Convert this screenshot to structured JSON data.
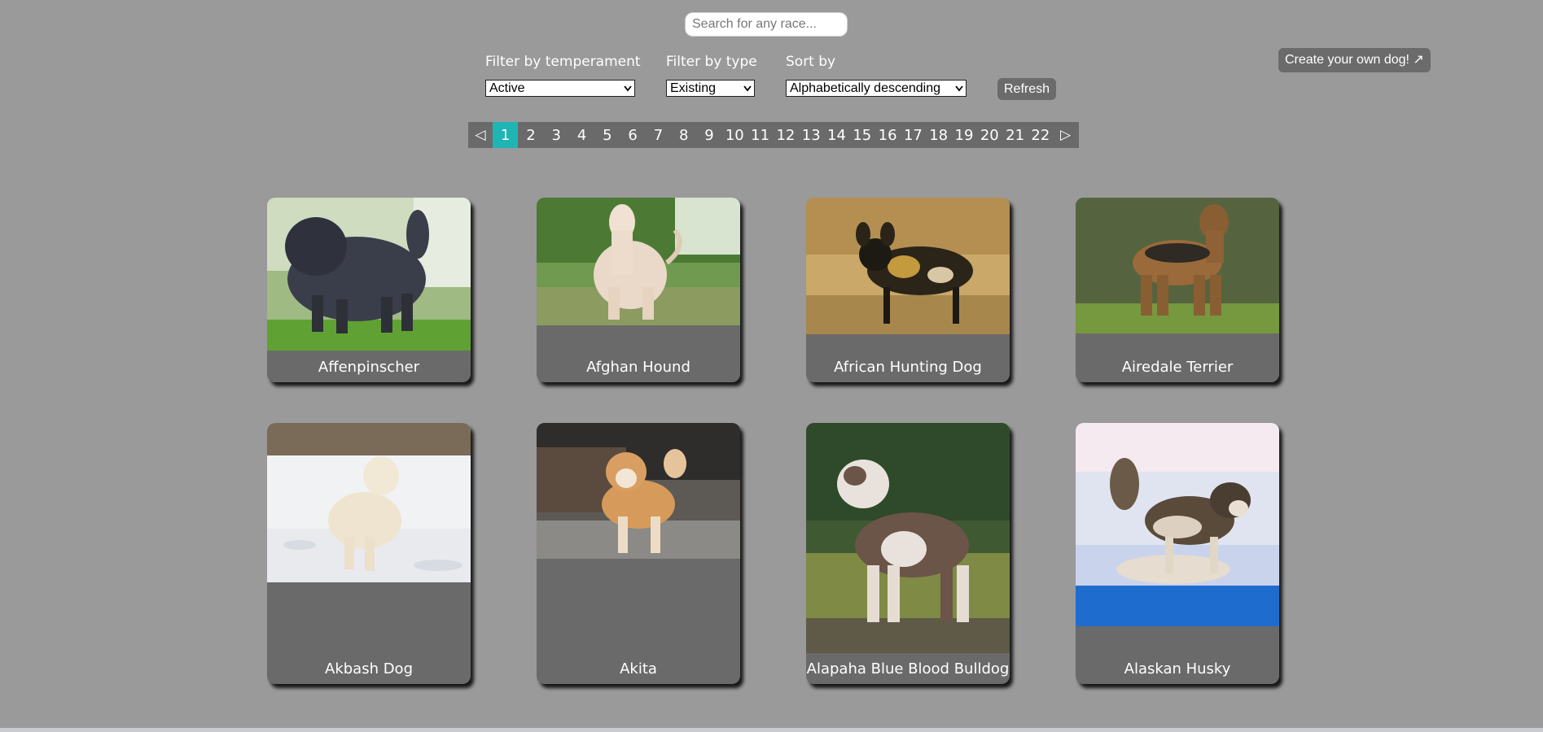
{
  "search": {
    "placeholder": "Search for any race..."
  },
  "filters": {
    "temperament": {
      "label": "Filter by temperament",
      "value": "Active"
    },
    "type": {
      "label": "Filter by type",
      "value": "Existing"
    },
    "sort": {
      "label": "Sort by",
      "value": "Alphabetically descending"
    }
  },
  "refresh_label": "Refresh",
  "create_label": "Create your own dog! ↗",
  "pagination": {
    "prev_symbol": "◁",
    "next_symbol": "▷",
    "pages": [
      "1",
      "2",
      "3",
      "4",
      "5",
      "6",
      "7",
      "8",
      "9",
      "10",
      "11",
      "12",
      "13",
      "14",
      "15",
      "16",
      "17",
      "18",
      "19",
      "20",
      "21",
      "22"
    ],
    "current_page": "1",
    "active_color": "#1fb5b5"
  },
  "breeds": [
    {
      "name": "Affenpinscher"
    },
    {
      "name": "Afghan Hound"
    },
    {
      "name": "African Hunting Dog"
    },
    {
      "name": "Airedale Terrier"
    },
    {
      "name": "Akbash Dog"
    },
    {
      "name": "Akita"
    },
    {
      "name": "Alapaha Blue Blood Bulldog"
    },
    {
      "name": "Alaskan Husky"
    }
  ]
}
